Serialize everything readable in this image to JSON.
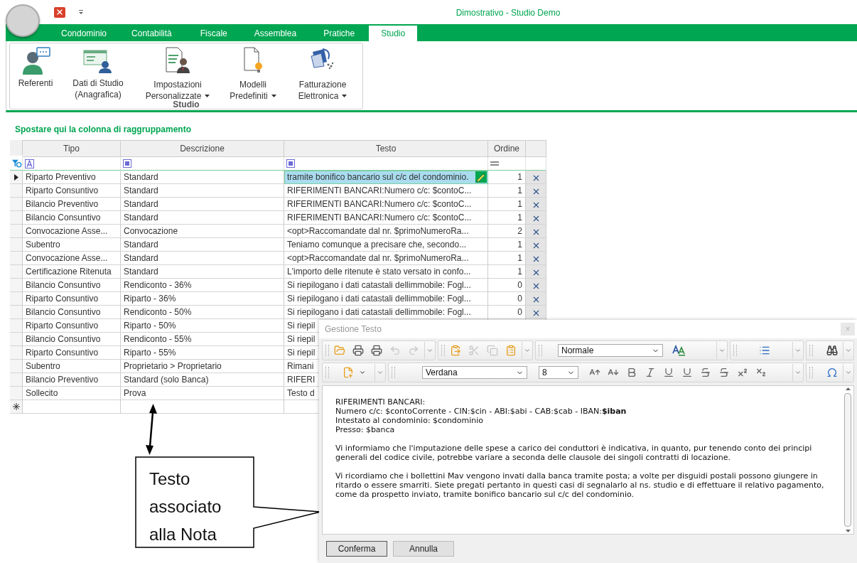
{
  "window": {
    "title": "Dimostrativo - Studio Demo"
  },
  "tabs": [
    {
      "label": "Condominio",
      "selected": false
    },
    {
      "label": "Contabilità",
      "selected": false
    },
    {
      "label": "Fiscale",
      "selected": false
    },
    {
      "label": "Assemblea",
      "selected": false
    },
    {
      "label": "Pratiche",
      "selected": false
    },
    {
      "label": "Studio",
      "selected": true
    }
  ],
  "ribbon_group": {
    "label": "Studio",
    "buttons": [
      {
        "lines": [
          "Referenti"
        ],
        "dropdown": false
      },
      {
        "lines": [
          "Dati di Studio",
          "(Anagrafica)"
        ],
        "dropdown": false
      },
      {
        "lines": [
          "Impostazioni",
          "Personalizzate"
        ],
        "dropdown": true
      },
      {
        "lines": [
          "Modelli",
          "Predefiniti"
        ],
        "dropdown": true
      },
      {
        "lines": [
          "Fatturazione",
          "Elettronica"
        ],
        "dropdown": true
      }
    ]
  },
  "grid": {
    "group_panel": "Spostare qui la colonna di raggruppamento",
    "columns": [
      "Tipo",
      "Descrizione",
      "Testo",
      "Ordine"
    ],
    "rows": [
      {
        "tipo": "Riparto Preventivo",
        "descrizione": "Standard",
        "testo": "tramite bonifico bancario sul c/c del condominio.",
        "ordine": "1",
        "selected": true
      },
      {
        "tipo": "Riparto Consuntivo",
        "descrizione": "Standard",
        "testo": "RIFERIMENTI BANCARI:Numero c/c: $contoC...",
        "ordine": "1",
        "selected": false
      },
      {
        "tipo": "Bilancio Preventivo",
        "descrizione": "Standard",
        "testo": "RIFERIMENTI BANCARI:Numero c/c: $contoC...",
        "ordine": "1",
        "selected": false
      },
      {
        "tipo": "Bilancio Consuntivo",
        "descrizione": "Standard",
        "testo": "RIFERIMENTI BANCARI:Numero c/c: $contoC...",
        "ordine": "1",
        "selected": false
      },
      {
        "tipo": "Convocazione Asse...",
        "descrizione": "Convocazione",
        "testo": "<opt>Raccomandate dal nr. $primoNumeroRa...",
        "ordine": "2",
        "selected": false
      },
      {
        "tipo": "Subentro",
        "descrizione": "Standard",
        "testo": "Teniamo comunque a precisare che, secondo...",
        "ordine": "1",
        "selected": false
      },
      {
        "tipo": "Convocazione Asse...",
        "descrizione": "Standard",
        "testo": "<opt>Raccomandate dal nr. $primoNumeroRa...",
        "ordine": "1",
        "selected": false
      },
      {
        "tipo": "Certificazione Ritenuta",
        "descrizione": "Standard",
        "testo": "L'importo delle ritenute è stato versato in confo...",
        "ordine": "1",
        "selected": false
      },
      {
        "tipo": "Bilancio Consuntivo",
        "descrizione": "Rendiconto - 36%",
        "testo": "Si riepilogano i dati catastali dellimmobile: Fogl...",
        "ordine": "0",
        "selected": false
      },
      {
        "tipo": "Riparto Consuntivo",
        "descrizione": "Riparto - 36%",
        "testo": "Si riepilogano i dati catastali dellimmobile: Fogl...",
        "ordine": "0",
        "selected": false
      },
      {
        "tipo": "Bilancio Consuntivo",
        "descrizione": "Rendiconto - 50%",
        "testo": "Si riepilogano i dati catastali dellimmobile: Fogl...",
        "ordine": "0",
        "selected": false
      },
      {
        "tipo": "Riparto Consuntivo",
        "descrizione": "Riparto - 50%",
        "testo": "Si riepil",
        "selected": false
      },
      {
        "tipo": "Bilancio Consuntivo",
        "descrizione": "Rendiconto - 55%",
        "testo": "Si riepil",
        "selected": false
      },
      {
        "tipo": "Riparto Consuntivo",
        "descrizione": "Riparto - 55%",
        "testo": "Si riepil",
        "selected": false
      },
      {
        "tipo": "Subentro",
        "descrizione": "Proprietario > Proprietario",
        "testo": "Rimani",
        "selected": false
      },
      {
        "tipo": "Bilancio Preventivo",
        "descrizione": "Standard (solo Banca)",
        "testo": "RIFERI",
        "selected": false
      },
      {
        "tipo": "Sollecito",
        "descrizione": "Prova",
        "testo": "Testo d",
        "selected": false
      }
    ]
  },
  "dialog": {
    "title": "Gestione Testo",
    "close": "×",
    "edit_tools": [
      {
        "disabled": false
      },
      {
        "disabled": false
      },
      {
        "disabled": false
      },
      {
        "disabled": true
      },
      {
        "disabled": true
      },
      {
        "disabled": false
      },
      {
        "disabled": true
      },
      {
        "disabled": true
      },
      {
        "disabled": false
      }
    ],
    "style": "Normale",
    "font": "Verdana",
    "size": "8",
    "content": [
      {
        "lines": [
          "RIFERIMENTI BANCARI:",
          "Numero c/c: $contoCorrente - CIN:$cin - ABI:$abi - CAB:$cab - IBAN:**$iban**",
          "Intestato al condominio: $condominio",
          "Presso: $banca"
        ]
      },
      {
        "lines": [
          "Vi informiamo che l'imputazione delle spese a carico dei conduttori è indicativa, in quanto, pur tenendo conto dei principi generali del codice civile, potrebbe variare a seconda delle clausole dei singoli contratti di locazione."
        ]
      },
      {
        "lines": [
          "Vi ricordiamo che i bollettini Mav vengono invati dalla banca tramite posta; a volte per disguidi postali possono giungere in ritardo o essere smarriti. Siete pregati pertanto in questi casi di segnalarlo al ns. studio e di effettuare il relativo pagamento, come da prospetto inviato, tramite bonifico bancario sul c/c del condominio."
        ]
      }
    ],
    "buttons": [
      {
        "label": "Conferma",
        "focused": true
      },
      {
        "label": "Annulla",
        "focused": false
      }
    ]
  },
  "callout": {
    "text": "Testo associato alla Nota"
  }
}
